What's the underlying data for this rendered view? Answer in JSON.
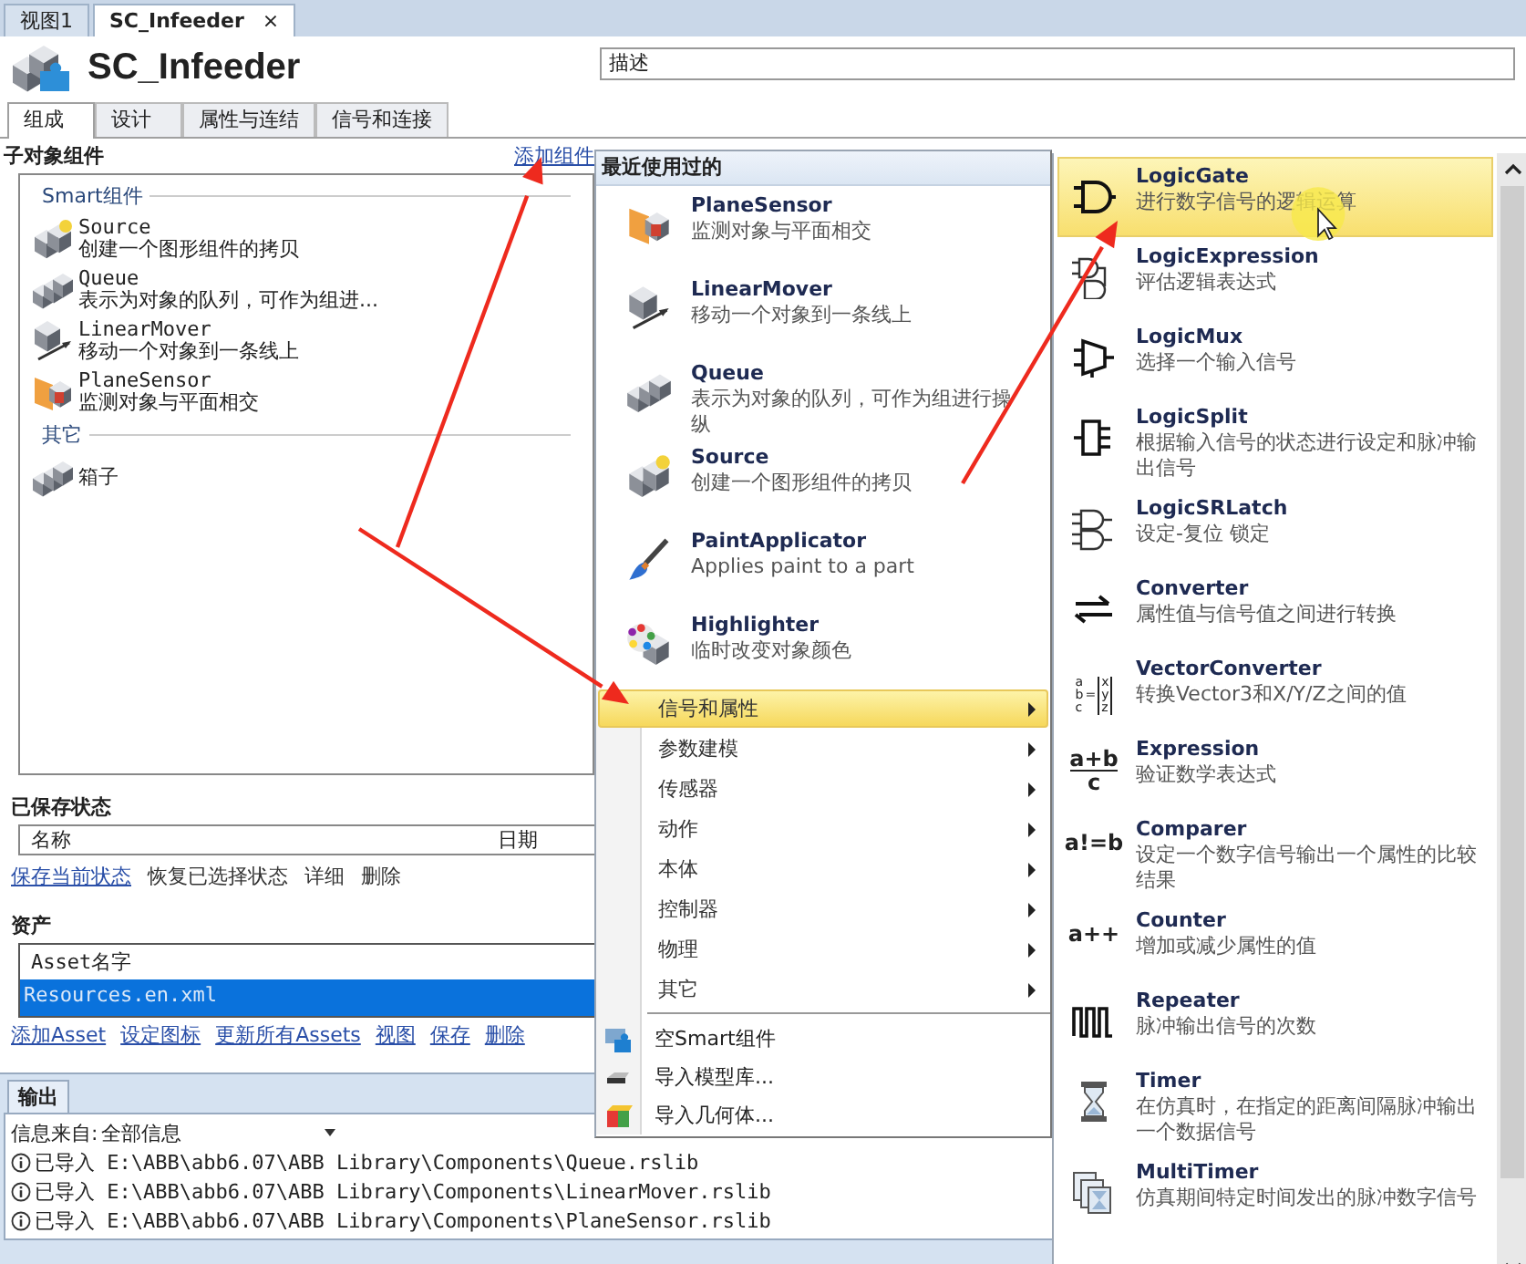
{
  "doc_tabs": [
    {
      "label": "视图1",
      "selected": false
    },
    {
      "label": "SC_Infeeder",
      "selected": true,
      "close": "×"
    }
  ],
  "header": {
    "title": "SC_Infeeder",
    "description": "描述"
  },
  "tabs": [
    {
      "label": "组成",
      "selected": true
    },
    {
      "label": "设计",
      "selected": false
    },
    {
      "label": "属性与连结",
      "selected": false
    },
    {
      "label": "信号和连接",
      "selected": false
    }
  ],
  "components": {
    "title": "子对象组件",
    "add_link": "添加组件",
    "groups": [
      {
        "heading": "Smart组件",
        "items": [
          {
            "name": "Source",
            "description": "创建一个图形组件的拷贝",
            "kind": "source"
          },
          {
            "name": "Queue",
            "description": "表示为对象的队列，可作为组进...",
            "kind": "queue"
          },
          {
            "name": "LinearMover",
            "description": "移动一个对象到一条线上",
            "kind": "mover"
          },
          {
            "name": "PlaneSensor",
            "description": "监测对象与平面相交",
            "kind": "sensor"
          }
        ]
      },
      {
        "heading": "其它",
        "items": [
          {
            "name": "箱子",
            "kind": "box"
          }
        ]
      }
    ]
  },
  "saved_states": {
    "title": "已保存状态",
    "columns": [
      "名称",
      "日期"
    ],
    "actions": [
      {
        "label": "保存当前状态",
        "kind": "link"
      },
      {
        "label": "恢复已选择状态",
        "kind": "plain"
      },
      {
        "label": "详细",
        "kind": "plain"
      },
      {
        "label": "删除",
        "kind": "plain"
      }
    ]
  },
  "assets": {
    "title": "资产",
    "column": "Asset名字",
    "rows": [
      {
        "label": "Resources.en.xml",
        "selected": true
      }
    ],
    "actions": [
      "添加Asset",
      "设定图标",
      "更新所有Assets",
      "视图",
      "保存",
      "删除"
    ]
  },
  "output": {
    "tab": "输出",
    "filter_label": "信息来自:",
    "filter_value": "全部信息",
    "messages": [
      "已导入 E:\\ABB\\abb6.07\\ABB Library\\Components\\Queue.rslib",
      "已导入 E:\\ABB\\abb6.07\\ABB Library\\Components\\LinearMover.rslib",
      "已导入 E:\\ABB\\abb6.07\\ABB Library\\Components\\PlaneSensor.rslib"
    ]
  },
  "add_menu": {
    "heading": "最近使用过的",
    "recent": [
      {
        "name": "PlaneSensor",
        "description": "监测对象与平面相交",
        "kind": "sensor"
      },
      {
        "name": "LinearMover",
        "description": "移动一个对象到一条线上",
        "kind": "mover"
      },
      {
        "name": "Queue",
        "description": "表示为对象的队列，可作为组进行操纵",
        "kind": "queue"
      },
      {
        "name": "Source",
        "description": "创建一个图形组件的拷贝",
        "kind": "source"
      },
      {
        "name": "PaintApplicator",
        "description": "Applies paint to a part",
        "kind": "paint"
      },
      {
        "name": "Highlighter",
        "description": "临时改变对象颜色",
        "kind": "highlighter"
      }
    ],
    "categories": [
      {
        "label": "信号和属性",
        "selected": true
      },
      {
        "label": "参数建模",
        "selected": false
      },
      {
        "label": "传感器",
        "selected": false
      },
      {
        "label": "动作",
        "selected": false
      },
      {
        "label": "本体",
        "selected": false
      },
      {
        "label": "控制器",
        "selected": false
      },
      {
        "label": "物理",
        "selected": false
      },
      {
        "label": "其它",
        "selected": false
      }
    ],
    "commands": [
      {
        "label": "空Smart组件",
        "kind": "smart"
      },
      {
        "label": "导入模型库...",
        "kind": "library"
      },
      {
        "label": "导入几何体...",
        "kind": "geometry"
      }
    ]
  },
  "submenu": {
    "items": [
      {
        "name": "LogicGate",
        "description": "进行数字信号的逻辑运算",
        "kind": "gate",
        "selected": true
      },
      {
        "name": "LogicExpression",
        "description": "评估逻辑表达式",
        "kind": "gates",
        "selected": false
      },
      {
        "name": "LogicMux",
        "description": "选择一个输入信号",
        "kind": "mux",
        "selected": false
      },
      {
        "name": "LogicSplit",
        "description": "根据输入信号的状态进行设定和脉冲输出信号",
        "kind": "split",
        "selected": false
      },
      {
        "name": "LogicSRLatch",
        "description": "设定-复位 锁定",
        "kind": "latch",
        "selected": false
      },
      {
        "name": "Converter",
        "description": "属性值与信号值之间进行转换",
        "kind": "converter",
        "selected": false
      },
      {
        "name": "VectorConverter",
        "description": "转换Vector3和X/Y/Z之间的值",
        "kind": "vector",
        "glyph": "abc",
        "glyph_mid": "=",
        "glyph_right": "xyz",
        "selected": false
      },
      {
        "name": "Expression",
        "description": "验证数学表达式",
        "kind": "fraction",
        "glyph": "a+b",
        "glyph_right": "c",
        "selected": false
      },
      {
        "name": "Comparer",
        "description": "设定一个数字信号输出一个属性的比较结果",
        "kind": "symbol",
        "glyph": "a!=b",
        "selected": false
      },
      {
        "name": "Counter",
        "description": "增加或减少属性的值",
        "kind": "symbol",
        "glyph": "a++",
        "selected": false
      },
      {
        "name": "Repeater",
        "description": "脉冲输出信号的次数",
        "kind": "repeater",
        "selected": false
      },
      {
        "name": "Timer",
        "description": "在仿真时，在指定的距离间隔脉冲输出一个数据信号",
        "kind": "timer",
        "selected": false
      },
      {
        "name": "MultiTimer",
        "description": "仿真期间特定时间发出的脉冲数字信号",
        "kind": "multitimer",
        "selected": false
      }
    ]
  }
}
